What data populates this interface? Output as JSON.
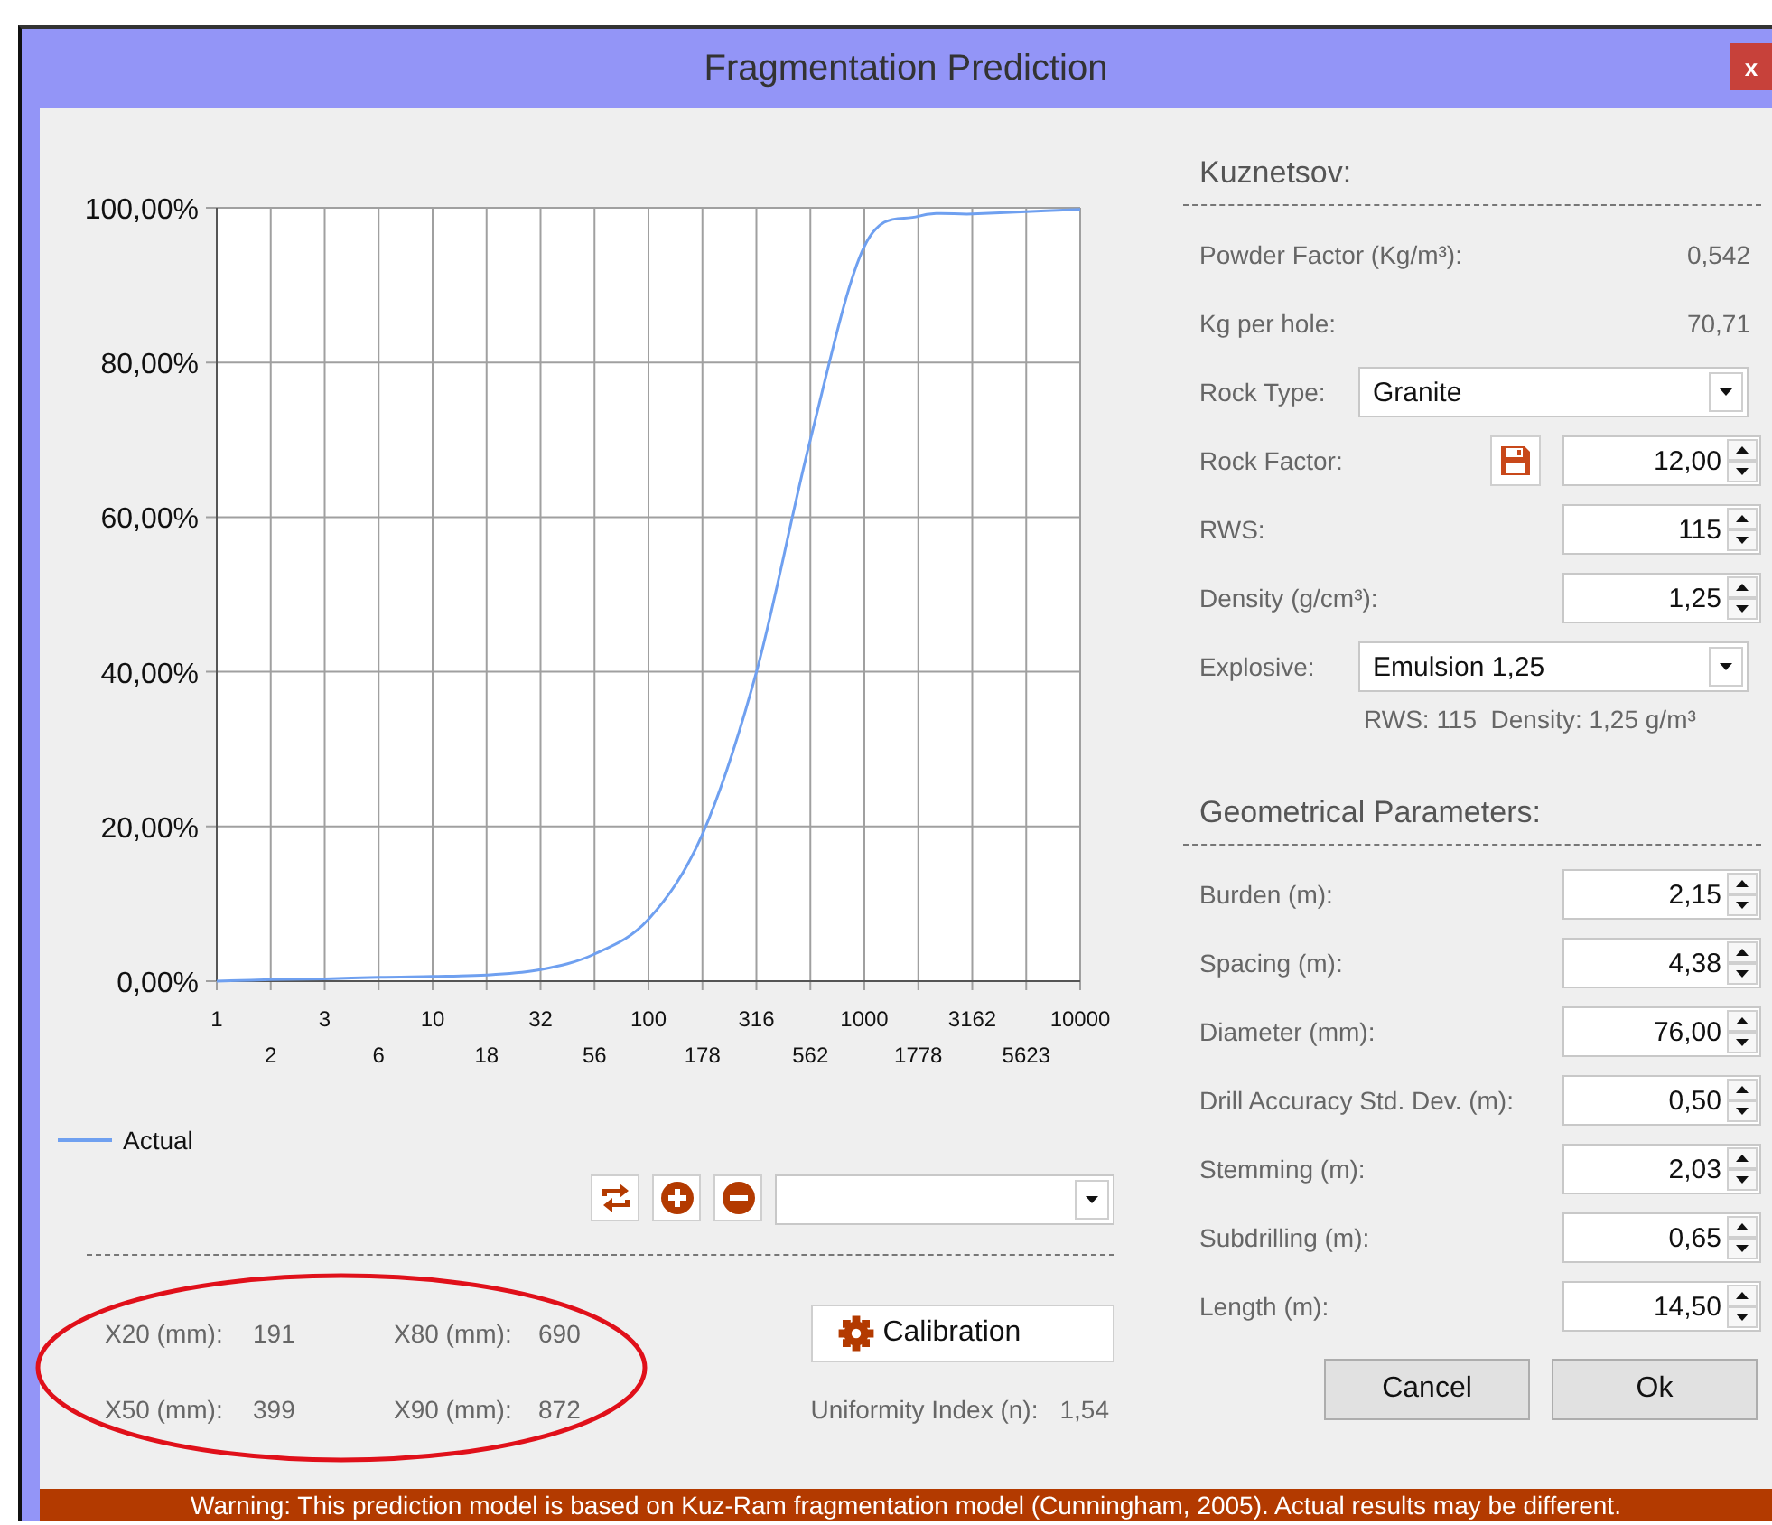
{
  "window": {
    "title": "Fragmentation Prediction",
    "close": "x"
  },
  "chart": {
    "chart_data": {
      "type": "line",
      "categories": [
        "1",
        "2",
        "3",
        "6",
        "10",
        "18",
        "32",
        "56",
        "100",
        "178",
        "316",
        "562",
        "1000",
        "1778",
        "3162",
        "5623",
        "10000"
      ],
      "series": [
        {
          "name": "Actual",
          "color": "#6fa0f0",
          "values": [
            0,
            0.2,
            0.3,
            0.5,
            0.6,
            0.8,
            1.5,
            3.5,
            8,
            19,
            40,
            70,
            95,
            98.9,
            99.2,
            99.5,
            99.8
          ]
        }
      ],
      "ylim": [
        0,
        100
      ],
      "grid": true,
      "yticks": [
        {
          "value": 0,
          "label": "0,00%"
        },
        {
          "value": 20,
          "label": "20,00%"
        },
        {
          "value": 40,
          "label": "40,00%"
        },
        {
          "value": 60,
          "label": "60,00%"
        },
        {
          "value": 80,
          "label": "80,00%"
        },
        {
          "value": 100,
          "label": "100,00%"
        }
      ]
    }
  },
  "chart_toolbar": {
    "buttons": [
      {
        "kind": "reset"
      },
      {
        "kind": "zoom_in"
      },
      {
        "kind": "zoom_out"
      }
    ]
  },
  "results": [
    {
      "label": "X20 (mm):",
      "value": "191"
    },
    {
      "label": "X80 (mm):",
      "value": "690"
    },
    {
      "label": "X50 (mm):",
      "value": "399"
    },
    {
      "label": "X90 (mm):",
      "value": "872"
    }
  ],
  "annotation": {
    "kind": "ellipse"
  },
  "calibration_button": "Calibration",
  "uniformity": {
    "label": "Uniformity Index (n):",
    "value": "1,54"
  },
  "kuznetsov": {
    "title": "Kuznetsov:",
    "rows": [
      {
        "kind": "readout",
        "label": "Powder Factor (Kg/m³):",
        "value": "0,542"
      },
      {
        "kind": "readout",
        "label": "Kg per hole:",
        "value": "70,71"
      },
      {
        "kind": "dropdown",
        "label": "Rock Type:",
        "value": "Granite"
      },
      {
        "kind": "spin",
        "label": "Rock Factor:",
        "value": "12,00",
        "save_button": true
      },
      {
        "kind": "spin",
        "label": "RWS:",
        "value": "115"
      },
      {
        "kind": "spin",
        "label": "Density (g/cm³):",
        "value": "1,25"
      },
      {
        "kind": "dropdown",
        "label": "Explosive:",
        "value": "Emulsion 1,25"
      },
      {
        "kind": "note",
        "text": "RWS: 115  Density: 1,25 g/m³"
      }
    ]
  },
  "geometry": {
    "title": "Geometrical Parameters:",
    "rows": [
      {
        "kind": "spin",
        "label": "Burden (m):",
        "value": "2,15"
      },
      {
        "kind": "spin",
        "label": "Spacing (m):",
        "value": "4,38"
      },
      {
        "kind": "spin",
        "label": "Diameter (mm):",
        "value": "76,00"
      },
      {
        "kind": "spin",
        "label": "Drill Accuracy Std. Dev. (m):",
        "value": "0,50"
      },
      {
        "kind": "spin",
        "label": "Stemming (m):",
        "value": "2,03"
      },
      {
        "kind": "spin",
        "label": "Subdrilling (m):",
        "value": "0,65"
      },
      {
        "kind": "spin",
        "label": "Length (m):",
        "value": "14,50"
      }
    ]
  },
  "buttons": [
    "Cancel",
    "Ok"
  ],
  "warning": "Warning: This prediction model is based on Kuz-Ram fragmentation model (Cunningham, 2005). Actual results may be different."
}
